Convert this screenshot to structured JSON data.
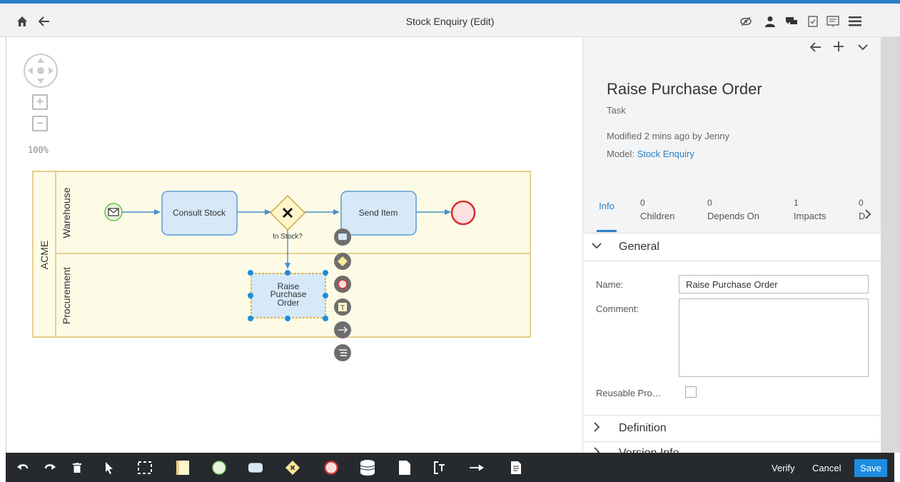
{
  "window": {
    "title": "Stock Enquiry (Edit)"
  },
  "topbar": {
    "left_icons": [
      "home-icon",
      "back-arrow-icon"
    ],
    "right_icons": [
      "hide-icon",
      "user-icon",
      "comments-icon",
      "checklist-icon",
      "presentation-icon",
      "menu-icon"
    ]
  },
  "canvas": {
    "zoom_label": "100%",
    "pool_label": "ACME",
    "lanes": [
      "Warehouse",
      "Procurement"
    ],
    "tasks": {
      "consult": "Consult Stock",
      "send": "Send Item",
      "raise_line1": "Raise",
      "raise_line2": "Purchase",
      "raise_line3": "Order"
    },
    "gateway_label": "In Stock?",
    "context_tools": [
      "task-tool-icon",
      "gateway-tool-icon",
      "end-event-tool-icon",
      "text-annotation-tool-icon",
      "connector-tool-icon",
      "more-tool-icon"
    ]
  },
  "panel": {
    "header_icons": [
      "back-arrow-icon",
      "plus-icon",
      "chevron-down-icon"
    ],
    "object_title": "Raise Purchase Order",
    "object_type": "Task",
    "modified": "Modified 2 mins ago by Jenny",
    "model_prefix": "Model:",
    "model_link": "Stock Enquiry",
    "tabs": [
      {
        "count": "",
        "label": "Info"
      },
      {
        "count": "0",
        "label": "Children"
      },
      {
        "count": "0",
        "label": "Depends On"
      },
      {
        "count": "1",
        "label": "Impacts"
      },
      {
        "count": "0",
        "label": "D"
      }
    ],
    "sections": {
      "general": "General",
      "definition": "Definition",
      "version": "Version Info"
    },
    "fields": {
      "name_label": "Name:",
      "name_value": "Raise Purchase Order",
      "comment_label": "Comment:",
      "comment_value": "",
      "reusable_label": "Reusable Pro…"
    }
  },
  "bottombar": {
    "tools": [
      "undo-icon",
      "redo-icon",
      "delete-icon",
      "pointer-icon",
      "select-area-icon",
      "pool-icon",
      "start-event-icon",
      "task-icon",
      "gateway-icon",
      "end-event-icon",
      "data-store-icon",
      "data-object-icon",
      "text-annotation-icon",
      "sequence-flow-icon",
      "document-icon"
    ],
    "verify": "Verify",
    "cancel": "Cancel",
    "save": "Save"
  },
  "colors": {
    "accent": "#2a7fc9",
    "save_bg": "#1d8ce0",
    "pool_fill": "#fdfbe6",
    "pool_border": "#e8cf8e",
    "task_fill": "#d6e9f8",
    "task_border": "#5b9bd5",
    "end_event": "#e04040"
  }
}
